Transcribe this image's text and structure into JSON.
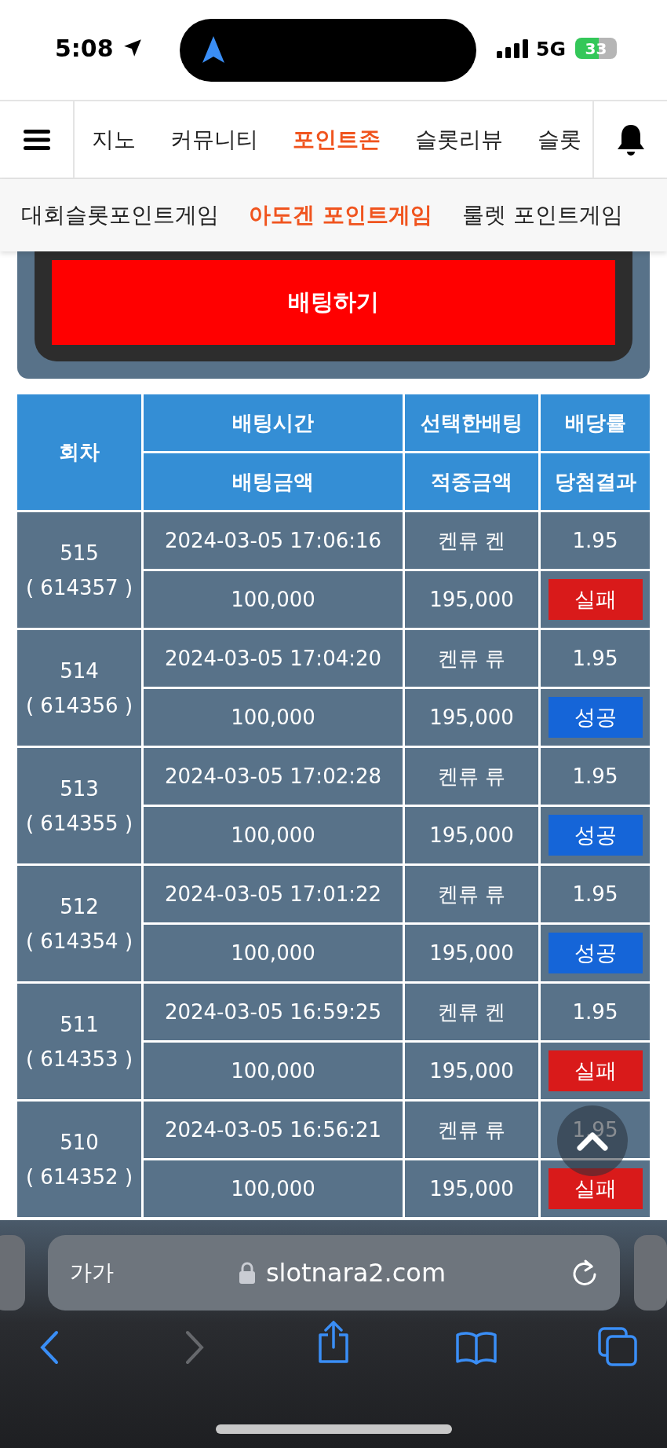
{
  "status_bar": {
    "time": "5:08",
    "network": "5G",
    "battery": "33"
  },
  "top_nav": {
    "tabs": [
      {
        "label": "지노",
        "selected": false
      },
      {
        "label": "커뮤니티",
        "selected": false
      },
      {
        "label": "포인트존",
        "selected": true
      },
      {
        "label": "슬롯리뷰",
        "selected": false
      },
      {
        "label": "슬롯",
        "selected": false
      }
    ]
  },
  "sub_nav": {
    "tabs": [
      {
        "label": "대회슬롯포인트게임",
        "selected": false
      },
      {
        "label": "아도겐 포인트게임",
        "selected": true
      },
      {
        "label": "룰렛 포인트게임",
        "selected": false
      }
    ]
  },
  "bet_button": "배팅하기",
  "table": {
    "header": {
      "round": "회차",
      "time": "배팅시간",
      "pick": "선택한배팅",
      "odds": "배당률",
      "amount": "배팅금액",
      "win_amount": "적중금액",
      "result": "당첨결과"
    },
    "rows": [
      {
        "round": "515",
        "id": "( 614357 )",
        "time": "2024-03-05 17:06:16",
        "pick": "켄류 켄",
        "odds": "1.95",
        "amount": "100,000",
        "win_amount": "195,000",
        "result": {
          "text": "실패",
          "kind": "fail"
        }
      },
      {
        "round": "514",
        "id": "( 614356 )",
        "time": "2024-03-05 17:04:20",
        "pick": "켄류 류",
        "odds": "1.95",
        "amount": "100,000",
        "win_amount": "195,000",
        "result": {
          "text": "성공",
          "kind": "success"
        }
      },
      {
        "round": "513",
        "id": "( 614355 )",
        "time": "2024-03-05 17:02:28",
        "pick": "켄류 류",
        "odds": "1.95",
        "amount": "100,000",
        "win_amount": "195,000",
        "result": {
          "text": "성공",
          "kind": "success"
        }
      },
      {
        "round": "512",
        "id": "( 614354 )",
        "time": "2024-03-05 17:01:22",
        "pick": "켄류 류",
        "odds": "1.95",
        "amount": "100,000",
        "win_amount": "195,000",
        "result": {
          "text": "성공",
          "kind": "success"
        }
      },
      {
        "round": "511",
        "id": "( 614353 )",
        "time": "2024-03-05 16:59:25",
        "pick": "켄류 켄",
        "odds": "1.95",
        "amount": "100,000",
        "win_amount": "195,000",
        "result": {
          "text": "실패",
          "kind": "fail"
        }
      },
      {
        "round": "510",
        "id": "( 614352 )",
        "time": "2024-03-05 16:56:21",
        "pick": "켄류 류",
        "odds": "1.95",
        "amount": "100,000",
        "win_amount": "195,000",
        "result": {
          "text": "실패",
          "kind": "fail"
        }
      }
    ]
  },
  "browser": {
    "text_size": "가가",
    "url": "slotnara2.com"
  }
}
